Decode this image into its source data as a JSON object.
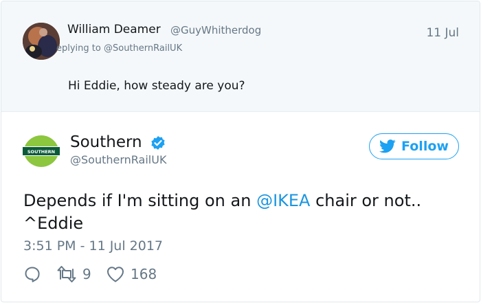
{
  "parent_tweet": {
    "author_name": "William Deamer",
    "author_handle": "@GuyWhitherdog",
    "date": "11 Jul",
    "replying_prefix": "eplying to ",
    "replying_handle": "@SouthernRailUK",
    "text": "Hi Eddie, how steady are you?"
  },
  "main_tweet": {
    "author_name": "Southern",
    "author_handle": "@SouthernRailUK",
    "avatar_logo_text": "SOUTHERN",
    "follow_label": "Follow",
    "text_before": "Depends if I'm sitting on an ",
    "mention": "@IKEA",
    "text_after": " chair or not..",
    "text_line2": "^Eddie",
    "timestamp": "3:51 PM - 11 Jul 2017",
    "retweet_count": "9",
    "like_count": "168"
  },
  "colors": {
    "accent": "#1da1f2",
    "muted_text": "#657786",
    "parent_background": "#f5f8fa",
    "southern_green": "#8dc63f",
    "southern_dark": "#0b5a3a"
  },
  "icons": {
    "reply": "reply-icon",
    "retweet": "retweet-icon",
    "like": "heart-icon",
    "follow": "twitter-bird-icon",
    "verified": "verified-badge-icon"
  }
}
